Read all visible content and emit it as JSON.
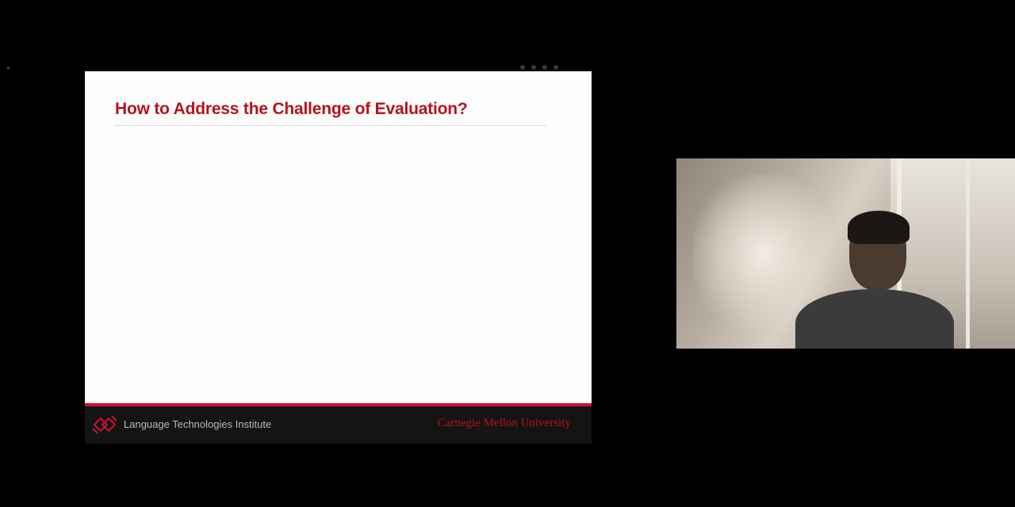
{
  "slide": {
    "title": "How to Address the Challenge of Evaluation?",
    "footer_left": "Language Technologies Institute",
    "footer_right": "Carnegie Mellon University"
  },
  "colors": {
    "title_red": "#b5121b",
    "footer_bar_red": "#c8102e",
    "footer_bg": "#141414",
    "background": "#000000"
  },
  "webcam": {
    "icon": "webcam-feed"
  }
}
